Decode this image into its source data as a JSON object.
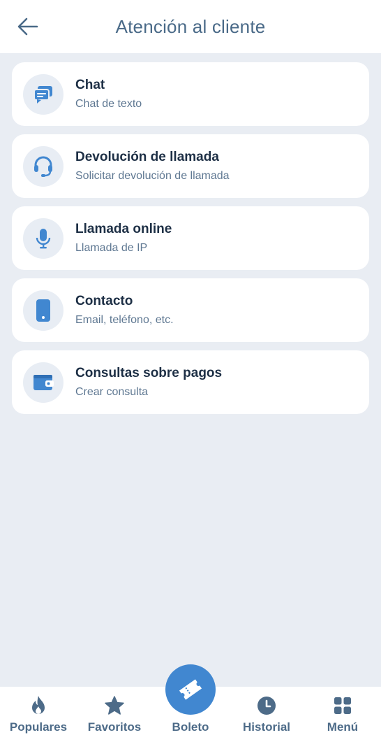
{
  "header": {
    "title": "Atención al cliente",
    "back_icon": "arrow-left-icon"
  },
  "colors": {
    "accent": "#4187d0",
    "background": "#e9edf3",
    "card": "#ffffff",
    "title_text": "#1d2f45",
    "muted_text": "#5f7892"
  },
  "options": [
    {
      "title": "Chat",
      "subtitle": "Chat de texto",
      "icon": "chat-bubbles-icon"
    },
    {
      "title": "Devolución de llamada",
      "subtitle": "Solicitar devolución de llamada",
      "icon": "headset-icon"
    },
    {
      "title": "Llamada online",
      "subtitle": "Llamada de IP",
      "icon": "microphone-icon"
    },
    {
      "title": "Contacto",
      "subtitle": "Email, teléfono, etc.",
      "icon": "phone-icon"
    },
    {
      "title": "Consultas sobre pagos",
      "subtitle": "Crear consulta",
      "icon": "wallet-icon"
    }
  ],
  "nav": {
    "populares": {
      "label": "Populares",
      "icon": "flame-icon"
    },
    "favoritos": {
      "label": "Favoritos",
      "icon": "star-icon"
    },
    "boleto": {
      "label": "Boleto",
      "icon": "ticket-icon"
    },
    "historial": {
      "label": "Historial",
      "icon": "clock-icon"
    },
    "menu": {
      "label": "Menú",
      "icon": "grid-icon"
    }
  }
}
